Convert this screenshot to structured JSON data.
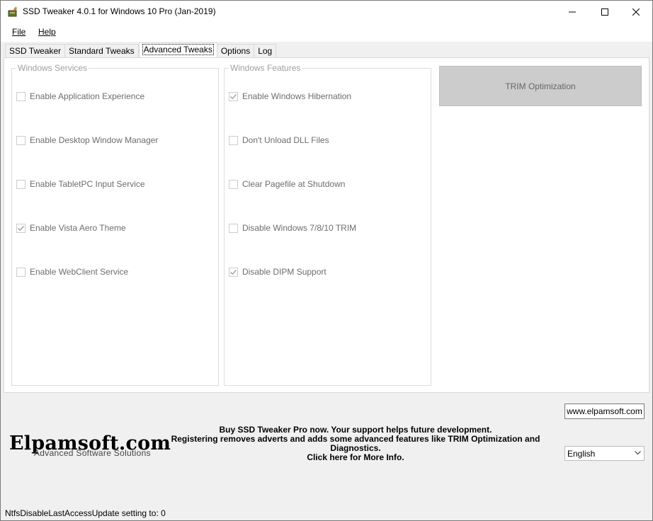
{
  "window": {
    "title": "SSD Tweaker 4.0.1 for Windows 10 Pro (Jan-2019)"
  },
  "menu": {
    "file": "File",
    "help": "Help"
  },
  "tabs": [
    {
      "label": "SSD Tweaker",
      "active": false
    },
    {
      "label": "Standard Tweaks",
      "active": false
    },
    {
      "label": "Advanced Tweaks",
      "active": true
    },
    {
      "label": "Options",
      "active": false
    },
    {
      "label": "Log",
      "active": false
    }
  ],
  "services": {
    "legend": "Windows Services",
    "items": [
      {
        "label": "Enable Application Experience",
        "checked": false
      },
      {
        "label": "Enable Desktop Window Manager",
        "checked": false
      },
      {
        "label": "Enable TabletPC Input Service",
        "checked": false
      },
      {
        "label": "Enable Vista Aero Theme",
        "checked": true
      },
      {
        "label": "Enable WebClient Service",
        "checked": false
      }
    ]
  },
  "features": {
    "legend": "Windows Features",
    "items": [
      {
        "label": "Enable Windows Hibernation",
        "checked": true
      },
      {
        "label": "Don't Unload DLL Files",
        "checked": false
      },
      {
        "label": "Clear Pagefile at Shutdown",
        "checked": false
      },
      {
        "label": "Disable Windows 7/8/10 TRIM",
        "checked": false
      },
      {
        "label": "Disable DIPM Support",
        "checked": true
      }
    ]
  },
  "trim_button": "TRIM Optimization",
  "logo": {
    "main": "Elpamsoft.com",
    "sub": "Advanced Software Solutions"
  },
  "promo": {
    "line1": "Buy SSD Tweaker Pro now. Your support helps future development.",
    "line2": "Registering removes adverts and adds some advanced features like TRIM Optimization and Diagnostics.",
    "line3": "Click here for More Info."
  },
  "website_button": "www.elpamsoft.com",
  "language": {
    "selected": "English"
  },
  "status": "NtfsDisableLastAccessUpdate setting to: 0"
}
